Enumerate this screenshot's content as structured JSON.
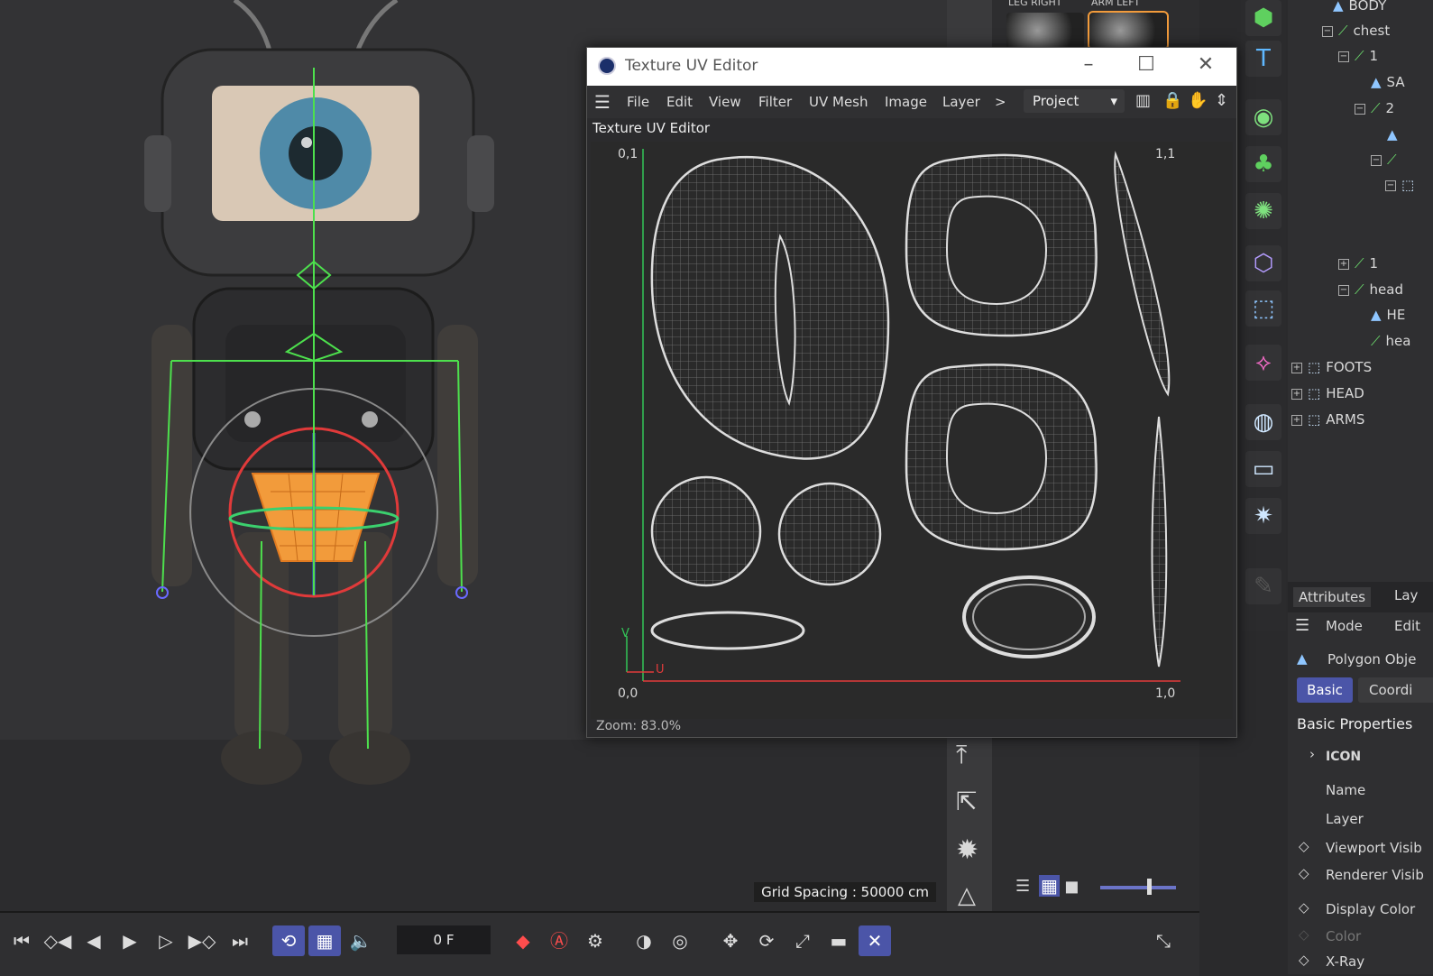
{
  "viewport": {
    "grid_spacing": "Grid Spacing : 50000 cm"
  },
  "uv_editor": {
    "title": "Texture UV Editor",
    "menu": [
      "File",
      "Edit",
      "View",
      "Filter",
      "UV Mesh",
      "Image",
      "Layer"
    ],
    "more": ">",
    "dropdown_value": "Project",
    "subtitle": "Texture UV Editor",
    "corner_labels": {
      "top_left": "0,1",
      "top_right": "1,1",
      "bottom_left": "0,0",
      "bottom_right": "1,0"
    },
    "axis_labels": {
      "v": "V",
      "u": "U"
    },
    "zoom": "Zoom: 83.0%"
  },
  "material_strip": {
    "labels": [
      "LEG RIGHT",
      "ARM LEFT"
    ]
  },
  "object_manager": {
    "items": [
      {
        "label": "BODY",
        "type": "poly"
      },
      {
        "label": "chest",
        "type": "bone"
      },
      {
        "label": "1",
        "type": "bone"
      },
      {
        "label": "SA",
        "type": "poly"
      },
      {
        "label": "2",
        "type": "bone"
      },
      {
        "label": "1",
        "type": "bone"
      },
      {
        "label": "head",
        "type": "bone"
      },
      {
        "label": "HE",
        "type": "poly"
      },
      {
        "label": "hea",
        "type": "bone"
      },
      {
        "label": "FOOTS",
        "type": "null"
      },
      {
        "label": "HEAD",
        "type": "null"
      },
      {
        "label": "ARMS",
        "type": "null"
      }
    ]
  },
  "attributes": {
    "tabs": [
      "Attributes",
      "Lay"
    ],
    "mode": "Mode",
    "edit": "Edit",
    "object_type": "Polygon Obje",
    "btn_basic": "Basic",
    "btn_coord": "Coordi",
    "section": "Basic Properties",
    "group": "ICON",
    "fields": [
      "Name",
      "Layer",
      "Viewport Visib",
      "Renderer Visib",
      "Display Color",
      "Color",
      "X-Ray"
    ]
  },
  "timeline": {
    "frame": "0 F"
  },
  "colors": {
    "accent": "#4b55a8",
    "bone": "#4de04d",
    "selection_orange": "#f29b3b",
    "axis_u": "#e23b3b",
    "axis_v": "#33c457"
  }
}
